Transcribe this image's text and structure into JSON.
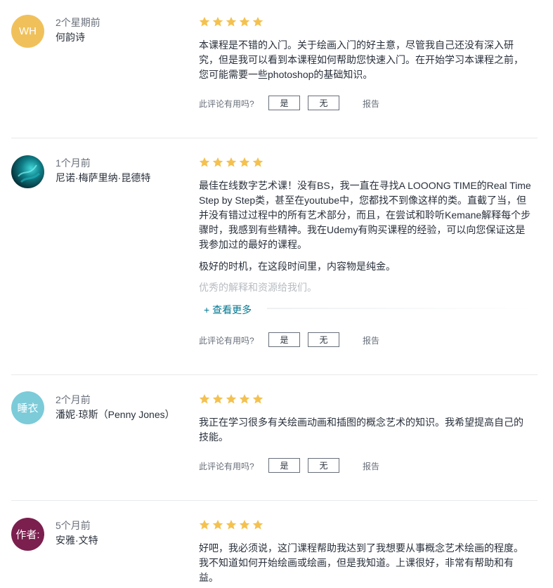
{
  "colors": {
    "star": "#f4c150",
    "link": "#007791",
    "divider": "#e8e9eb"
  },
  "helpful_label": "此评论有用吗?",
  "yes_label": "是",
  "no_label": "无",
  "report_label": "报告",
  "reviews": [
    {
      "avatar": {
        "text": "WH",
        "color": "#f0c15b"
      },
      "time": "2个星期前",
      "name": "何韵诗",
      "rating": 5,
      "paragraphs": [
        "本课程是不错的入门。关于绘画入门的好主意，尽管我自己还没有深入研究，但是我可以看到本课程如何帮助您快速入门。在开始学习本课程之前，您可能需要一些photoshop的基础知识。"
      ]
    },
    {
      "avatar": {
        "text": "",
        "color": "#0a4a55"
      },
      "time": "1个月前",
      "name": "尼诺·梅萨里纳·昆德特",
      "rating": 5,
      "paragraphs": [
        "最佳在线数字艺术课！没有BS，我一直在寻找A LOOONG TIME的Real Time Step by Step类，甚至在youtube中，您都找不到像这样的类。直截了当，但并没有错过过程中的所有艺术部分，而且，在尝试和聆听Kemane解释每个步骤时，我感到有些精神。我在Udemy有购买课程的经验，可以向您保证这是我参加过的最好的课程。",
        "极好的时机，在这段时间里，内容物是纯金。",
        "优秀的解释和资源给我们。"
      ],
      "see_more": "+ 查看更多"
    },
    {
      "avatar": {
        "text": "睡衣",
        "color": "#7ccbd9"
      },
      "time": "2个月前",
      "name": "潘妮·琼斯（Penny Jones）",
      "rating": 5,
      "paragraphs": [
        "我正在学习很多有关绘画动画和插图的概念艺术的知识。我希望提高自己的技能。"
      ]
    },
    {
      "avatar": {
        "text": "作者:",
        "color": "#7b1f4e"
      },
      "time": "5个月前",
      "name": "安雅·文特",
      "rating": 5,
      "paragraphs": [
        "好吧，我必须说，这门课程帮助我达到了我想要从事概念艺术绘画的程度。我不知道如何开始绘画或绘画，但是我知道。上课很好，非常有帮助和有益。"
      ]
    }
  ]
}
